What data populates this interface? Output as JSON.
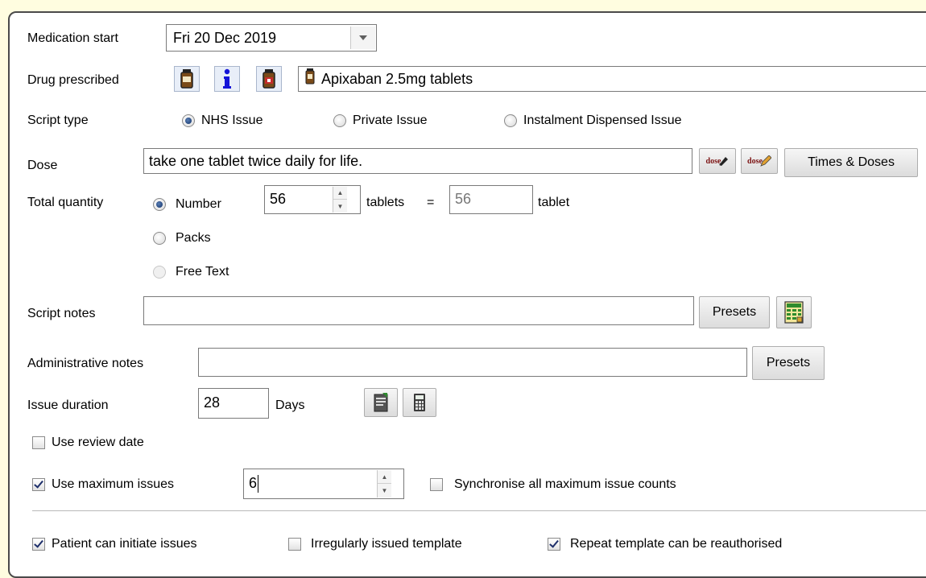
{
  "medication_start": {
    "label": "Medication start",
    "value": "Fri 20 Dec 2019"
  },
  "drug_prescribed": {
    "label": "Drug prescribed",
    "value": "Apixaban 2.5mg tablets"
  },
  "script_type": {
    "label": "Script type",
    "options": [
      "NHS Issue",
      "Private Issue",
      "Instalment Dispensed Issue"
    ],
    "selected": "NHS Issue"
  },
  "dose": {
    "label": "Dose",
    "value": "take one tablet twice daily for life.",
    "icon1_text": "dose",
    "icon2_text": "dose",
    "times_doses_label": "Times & Doses"
  },
  "total_quantity": {
    "label": "Total quantity",
    "options": [
      "Number",
      "Packs",
      "Free Text"
    ],
    "selected": "Number",
    "number_value": "56",
    "unit_label": "tablets",
    "equals": "=",
    "computed_value": "56",
    "computed_unit": "tablet"
  },
  "script_notes": {
    "label": "Script notes",
    "value": "",
    "presets_label": "Presets"
  },
  "administrative_notes": {
    "label": "Administrative notes",
    "value": "",
    "presets_label": "Presets"
  },
  "issue_duration": {
    "label": "Issue duration",
    "value": "28",
    "unit": "Days"
  },
  "use_review_date": {
    "label": "Use review date",
    "checked": false
  },
  "use_maximum_issues": {
    "label": "Use maximum issues",
    "checked": true,
    "value": "6"
  },
  "synchronise": {
    "label": "Synchronise all maximum issue counts",
    "checked": false
  },
  "patient_can_initiate": {
    "label": "Patient can initiate issues",
    "checked": true
  },
  "irregularly_issued": {
    "label": "Irregularly issued template",
    "checked": false
  },
  "repeat_reauthorised": {
    "label": "Repeat template can be reauthorised",
    "checked": true
  },
  "colors": {
    "background": "#fffde0",
    "info_icon_blue": "#1414d8",
    "drug_bottle_brown": "#7a4a18",
    "bottle_cap_red": "#c42c2c",
    "calculator_green": "#2e8b2e"
  }
}
